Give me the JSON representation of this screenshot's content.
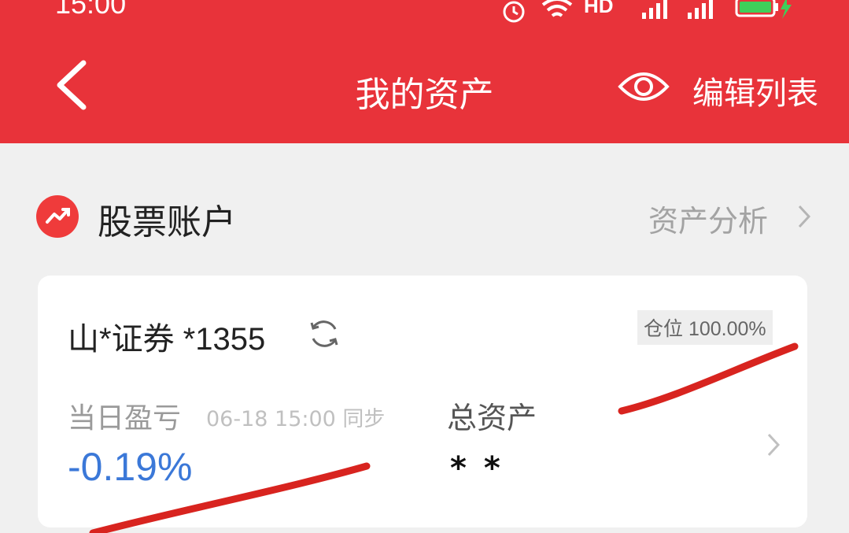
{
  "status_bar": {
    "time": "15:00",
    "icons": [
      "alarm-icon",
      "wifi-icon",
      "hd-icon",
      "signal-4g-icon",
      "signal-4g-icon",
      "battery-charging-icon"
    ],
    "hd_label": "HD"
  },
  "header": {
    "title": "我的资产",
    "edit_label": "编辑列表",
    "background": "#e8333a"
  },
  "section": {
    "title": "股票账户",
    "analysis_label": "资产分析",
    "icon": "stock-trend-icon"
  },
  "account": {
    "name": "山*证券 *1355",
    "position_label": "仓位 100.00%",
    "pnl_label": "当日盈亏",
    "pnl_sync": "06-18 15:00 同步",
    "pnl_value": "-0.19%",
    "pnl_color": "#3b78d8",
    "total_label": "总资产",
    "total_value": "* *"
  }
}
